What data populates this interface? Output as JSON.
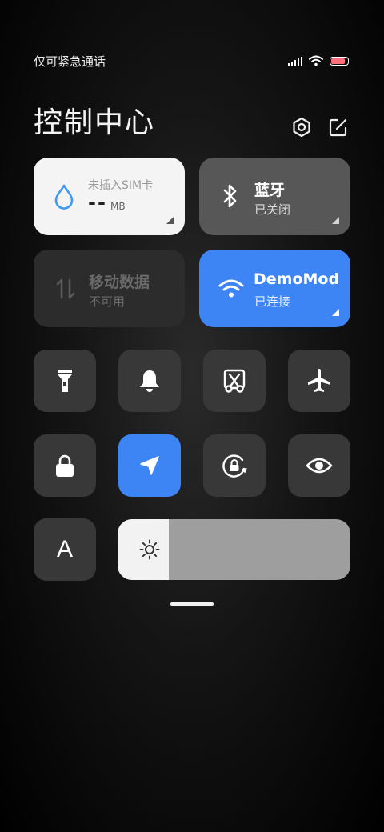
{
  "status_bar": {
    "carrier_text": "仅可紧急通话",
    "battery_level": 0.85
  },
  "header": {
    "title": "控制中心"
  },
  "tiles": {
    "data_usage": {
      "label": "未插入SIM卡",
      "value": "--",
      "unit": "MB"
    },
    "bluetooth": {
      "title": "蓝牙",
      "status": "已关闭"
    },
    "mobile_data": {
      "title": "移动数据",
      "status": "不可用"
    },
    "wifi": {
      "title": "DemoMod",
      "status": "已连接"
    }
  },
  "toggles": [
    {
      "icon": "flashlight-icon",
      "active": false
    },
    {
      "icon": "bell-icon",
      "active": false
    },
    {
      "icon": "screenshot-icon",
      "active": false
    },
    {
      "icon": "airplane-icon",
      "active": false
    },
    {
      "icon": "lock-icon",
      "active": false
    },
    {
      "icon": "location-icon",
      "active": true
    },
    {
      "icon": "rotation-lock-icon",
      "active": false
    },
    {
      "icon": "eye-icon",
      "active": false
    }
  ],
  "font_size_button": {
    "label": "A"
  },
  "brightness": {
    "level": 0.22
  },
  "colors": {
    "accent": "#3d84f5",
    "tile_dark": "#383838",
    "tile_light": "#f4f4f4"
  }
}
